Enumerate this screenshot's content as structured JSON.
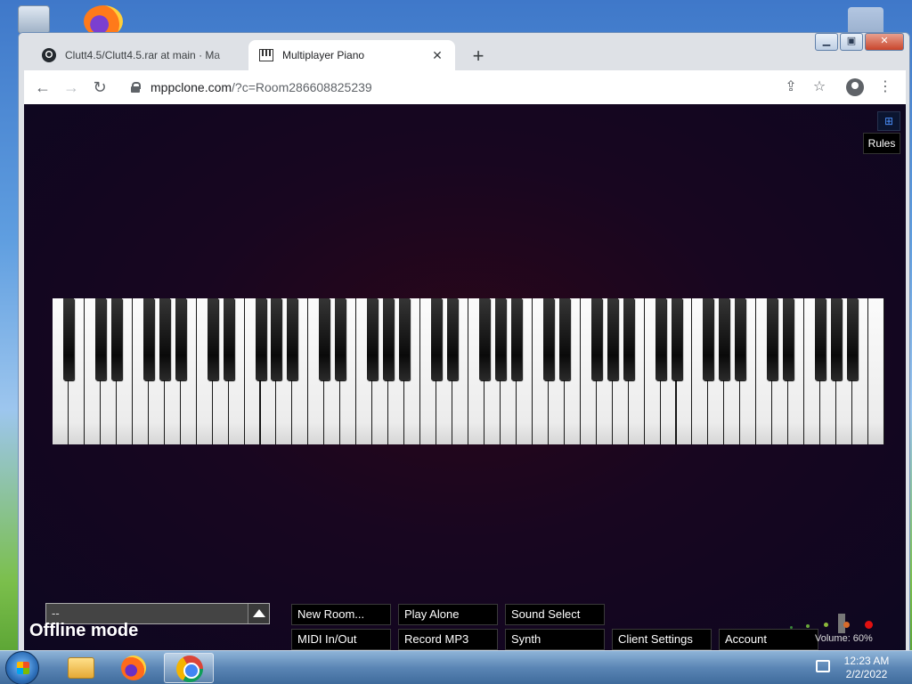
{
  "browser": {
    "tabs": [
      {
        "label": "Clutt4.5/Clutt4.5.rar at main · Ma",
        "favicon": "github-icon",
        "active": false
      },
      {
        "label": "Multiplayer Piano",
        "favicon": "piano-icon",
        "active": true
      }
    ],
    "url_host": "mppclone.com",
    "url_rest": "/?c=Room286608825239"
  },
  "page": {
    "rules_label": "Rules",
    "status_text": "Offline mode",
    "chat_select_value": "--",
    "buttons_row1": [
      "New Room...",
      "Play Alone",
      "Sound Select"
    ],
    "buttons_row2": [
      "MIDI In/Out",
      "Record MP3",
      "Synth",
      "Client Settings",
      "Account"
    ],
    "volume_text": "Volume: 60%",
    "volume": 0.6,
    "piano": {
      "white_keys": 52,
      "octave_pattern": "A0-C8"
    }
  },
  "taskbar": {
    "time": "12:23 AM",
    "date": "2/2/2022",
    "items": [
      "explorer-icon",
      "firefox-icon",
      "chrome-icon"
    ]
  }
}
